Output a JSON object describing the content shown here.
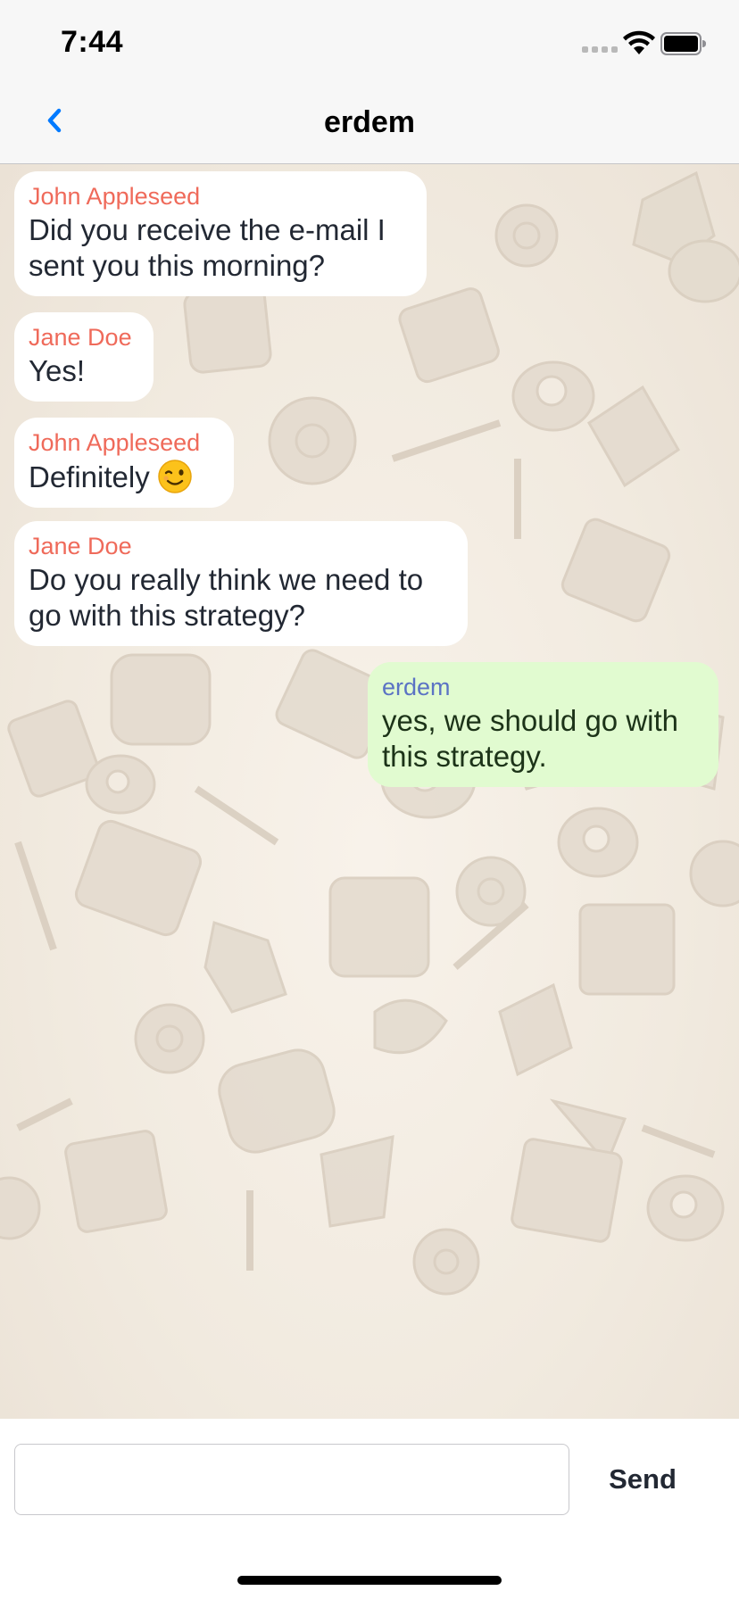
{
  "status_bar": {
    "time": "7:44",
    "icons": [
      "cellular-signal-icon",
      "wifi-icon",
      "battery-icon"
    ]
  },
  "nav": {
    "title": "erdem",
    "back_icon": "chevron-left-icon",
    "accent_color": "#007aff"
  },
  "messages": [
    {
      "sender": "John Appleseed",
      "text": "Did you receive the e-mail I sent you this morning?",
      "direction": "incoming"
    },
    {
      "sender": "Jane Doe",
      "text": "Yes!",
      "direction": "incoming"
    },
    {
      "sender": "John Appleseed",
      "text": "Definitely",
      "emoji": "winking-face",
      "direction": "incoming"
    },
    {
      "sender": "Jane Doe",
      "text": "Do you really think we need to go with this strategy?",
      "direction": "incoming"
    },
    {
      "sender": "erdem",
      "text": "yes, we should go with this strategy.",
      "direction": "outgoing"
    }
  ],
  "composer": {
    "value": "",
    "placeholder": "",
    "send_label": "Send"
  },
  "colors": {
    "incoming_sender": "#ef6a5a",
    "outgoing_sender": "#5b73c4",
    "outgoing_bubble": "#e1fbd0",
    "incoming_bubble": "#ffffff"
  }
}
